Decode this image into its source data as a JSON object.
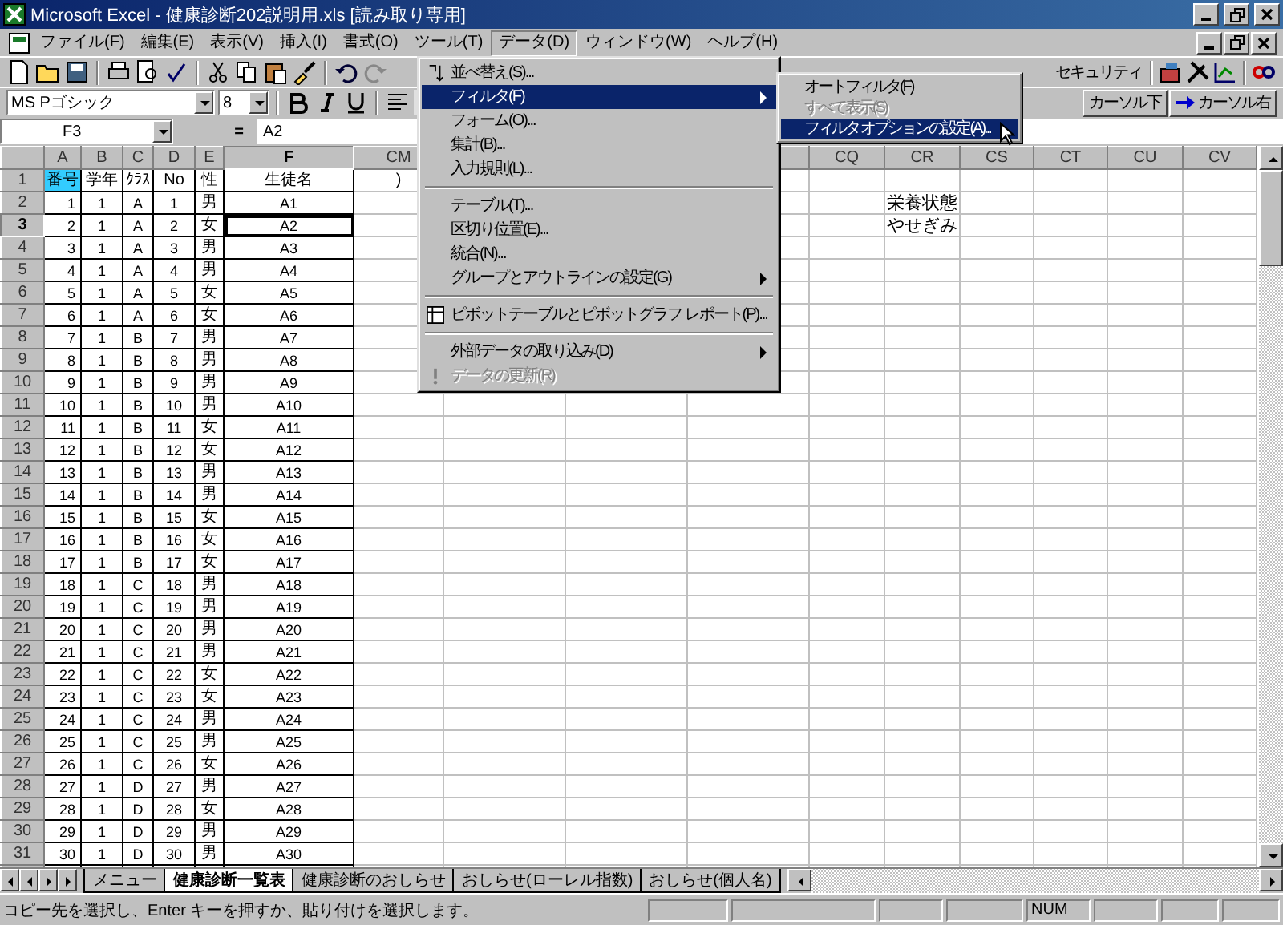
{
  "window": {
    "title": "Microsoft Excel - 健康診断202説明用.xls  [読み取り専用]"
  },
  "menu_bar": [
    {
      "label": "ファイル(F)",
      "selected": false
    },
    {
      "label": "編集(E)",
      "selected": false
    },
    {
      "label": "表示(V)",
      "selected": false
    },
    {
      "label": "挿入(I)",
      "selected": false
    },
    {
      "label": "書式(O)",
      "selected": false
    },
    {
      "label": "ツール(T)",
      "selected": false
    },
    {
      "label": "データ(D)",
      "selected": true
    },
    {
      "label": "ウィンドウ(W)",
      "selected": false
    },
    {
      "label": "ヘルプ(H)",
      "selected": false
    }
  ],
  "toolbar": {
    "security": "セキュリティ",
    "cursor_down": "カーソル下",
    "cursor_right": "カーソル右"
  },
  "format_bar": {
    "font": "MS Pゴシック",
    "size": "8"
  },
  "formula_bar": {
    "name_box": "F3",
    "equals": "=",
    "value": "A2"
  },
  "sheet": {
    "columns": [
      {
        "label": "A",
        "selected": false
      },
      {
        "label": "B",
        "selected": false
      },
      {
        "label": "C",
        "selected": false
      },
      {
        "label": "D",
        "selected": false
      },
      {
        "label": "E",
        "selected": false
      },
      {
        "label": "F",
        "selected": true
      },
      {
        "label": "CM",
        "selected": false
      },
      {
        "label": "CQ",
        "selected": false
      },
      {
        "label": "CR",
        "selected": false
      },
      {
        "label": "CS",
        "selected": false
      },
      {
        "label": "CT",
        "selected": false
      },
      {
        "label": "CU",
        "selected": false
      },
      {
        "label": "CV",
        "selected": false
      }
    ],
    "rows": [
      {
        "header": "1",
        "selected": false,
        "cells": [
          {
            "text": "番号",
            "highlighted": true
          },
          "学年",
          "ｸﾗｽ",
          "No",
          "性",
          "生徒名",
          ")"
        ]
      },
      {
        "header": "2",
        "selected": false,
        "cells": [
          "1",
          "1",
          "A",
          "1",
          "男",
          "A1",
          null,
          null,
          "栄養状態"
        ]
      },
      {
        "header": "3",
        "selected": true,
        "cells": [
          "2",
          "1",
          "A",
          "2",
          "女",
          "A2",
          null,
          null,
          "やせぎみ"
        ]
      },
      {
        "header": "4",
        "selected": false,
        "cells": [
          "3",
          "1",
          "A",
          "3",
          "男",
          "A3"
        ]
      },
      {
        "header": "5",
        "selected": false,
        "cells": [
          "4",
          "1",
          "A",
          "4",
          "男",
          "A4"
        ]
      },
      {
        "header": "6",
        "selected": false,
        "cells": [
          "5",
          "1",
          "A",
          "5",
          "女",
          "A5"
        ]
      },
      {
        "header": "7",
        "selected": false,
        "cells": [
          "6",
          "1",
          "A",
          "6",
          "女",
          "A6"
        ]
      },
      {
        "header": "8",
        "selected": false,
        "cells": [
          "7",
          "1",
          "B",
          "7",
          "男",
          "A7"
        ]
      },
      {
        "header": "9",
        "selected": false,
        "cells": [
          "8",
          "1",
          "B",
          "8",
          "男",
          "A8"
        ]
      },
      {
        "header": "10",
        "selected": false,
        "cells": [
          "9",
          "1",
          "B",
          "9",
          "男",
          "A9"
        ]
      },
      {
        "header": "11",
        "selected": false,
        "cells": [
          "10",
          "1",
          "B",
          "10",
          "男",
          "A10"
        ]
      },
      {
        "header": "12",
        "selected": false,
        "cells": [
          "11",
          "1",
          "B",
          "11",
          "女",
          "A11"
        ]
      },
      {
        "header": "13",
        "selected": false,
        "cells": [
          "12",
          "1",
          "B",
          "12",
          "女",
          "A12"
        ]
      },
      {
        "header": "14",
        "selected": false,
        "cells": [
          "13",
          "1",
          "B",
          "13",
          "男",
          "A13"
        ]
      },
      {
        "header": "15",
        "selected": false,
        "cells": [
          "14",
          "1",
          "B",
          "14",
          "男",
          "A14"
        ]
      },
      {
        "header": "16",
        "selected": false,
        "cells": [
          "15",
          "1",
          "B",
          "15",
          "女",
          "A15"
        ]
      },
      {
        "header": "17",
        "selected": false,
        "cells": [
          "16",
          "1",
          "B",
          "16",
          "女",
          "A16"
        ]
      },
      {
        "header": "18",
        "selected": false,
        "cells": [
          "17",
          "1",
          "B",
          "17",
          "女",
          "A17"
        ]
      },
      {
        "header": "19",
        "selected": false,
        "cells": [
          "18",
          "1",
          "C",
          "18",
          "男",
          "A18"
        ]
      },
      {
        "header": "20",
        "selected": false,
        "cells": [
          "19",
          "1",
          "C",
          "19",
          "男",
          "A19"
        ]
      },
      {
        "header": "21",
        "selected": false,
        "cells": [
          "20",
          "1",
          "C",
          "20",
          "男",
          "A20"
        ]
      },
      {
        "header": "22",
        "selected": false,
        "cells": [
          "21",
          "1",
          "C",
          "21",
          "男",
          "A21"
        ]
      },
      {
        "header": "23",
        "selected": false,
        "cells": [
          "22",
          "1",
          "C",
          "22",
          "女",
          "A22"
        ]
      },
      {
        "header": "24",
        "selected": false,
        "cells": [
          "23",
          "1",
          "C",
          "23",
          "女",
          "A23"
        ]
      },
      {
        "header": "25",
        "selected": false,
        "cells": [
          "24",
          "1",
          "C",
          "24",
          "男",
          "A24"
        ]
      },
      {
        "header": "26",
        "selected": false,
        "cells": [
          "25",
          "1",
          "C",
          "25",
          "男",
          "A25"
        ]
      },
      {
        "header": "27",
        "selected": false,
        "cells": [
          "26",
          "1",
          "C",
          "26",
          "女",
          "A26"
        ]
      },
      {
        "header": "28",
        "selected": false,
        "cells": [
          "27",
          "1",
          "D",
          "27",
          "男",
          "A27"
        ]
      },
      {
        "header": "29",
        "selected": false,
        "cells": [
          "28",
          "1",
          "D",
          "28",
          "女",
          "A28"
        ]
      },
      {
        "header": "30",
        "selected": false,
        "cells": [
          "29",
          "1",
          "D",
          "29",
          "男",
          "A29"
        ]
      },
      {
        "header": "31",
        "selected": false,
        "cells": [
          "30",
          "1",
          "D",
          "30",
          "男",
          "A30"
        ]
      }
    ]
  },
  "data_menu": [
    {
      "kind": "item",
      "label": "並べ替え(S)...",
      "selected": false,
      "disabled": false,
      "submenu": false
    },
    {
      "kind": "item",
      "label": "フィルタ(F)",
      "selected": true,
      "disabled": false,
      "submenu": true
    },
    {
      "kind": "item",
      "label": "フォーム(O)...",
      "selected": false,
      "disabled": false,
      "submenu": false
    },
    {
      "kind": "item",
      "label": "集計(B)...",
      "selected": false,
      "disabled": false,
      "submenu": false
    },
    {
      "kind": "item",
      "label": "入力規則(L)...",
      "selected": false,
      "disabled": false,
      "submenu": false
    },
    {
      "kind": "separator"
    },
    {
      "kind": "item",
      "label": "テーブル(T)...",
      "selected": false,
      "disabled": false,
      "submenu": false
    },
    {
      "kind": "item",
      "label": "区切り位置(E)...",
      "selected": false,
      "disabled": false,
      "submenu": false
    },
    {
      "kind": "item",
      "label": "統合(N)...",
      "selected": false,
      "disabled": false,
      "submenu": false
    },
    {
      "kind": "item",
      "label": "グループとアウトラインの設定(G)",
      "selected": false,
      "disabled": false,
      "submenu": true
    },
    {
      "kind": "separator"
    },
    {
      "kind": "item",
      "label": "ピボットテーブルとピボットグラフ レポート(P)...",
      "selected": false,
      "disabled": false,
      "submenu": false
    },
    {
      "kind": "separator"
    },
    {
      "kind": "item",
      "label": "外部データの取り込み(D)",
      "selected": false,
      "disabled": false,
      "submenu": true
    },
    {
      "kind": "item",
      "label": "データの更新(R)",
      "selected": false,
      "disabled": true,
      "submenu": false
    }
  ],
  "filter_submenu": [
    {
      "label": "オートフィルタ(F)",
      "selected": false,
      "disabled": false
    },
    {
      "label": "すべて表示(S)",
      "selected": false,
      "disabled": true
    },
    {
      "label": "フィルタ オプションの設定(A)...",
      "selected": true,
      "disabled": false
    }
  ],
  "sheet_tabs": [
    {
      "label": "メニュー",
      "selected": false
    },
    {
      "label": "健康診断一覧表",
      "selected": true
    },
    {
      "label": "健康診断のおしらせ",
      "selected": false
    },
    {
      "label": "おしらせ(ローレル指数)",
      "selected": false
    },
    {
      "label": "おしらせ(個人名)",
      "selected": false
    }
  ],
  "status_bar": {
    "message": "コピー先を選択し、Enter キーを押すか、貼り付けを選択します。",
    "num": "NUM"
  }
}
